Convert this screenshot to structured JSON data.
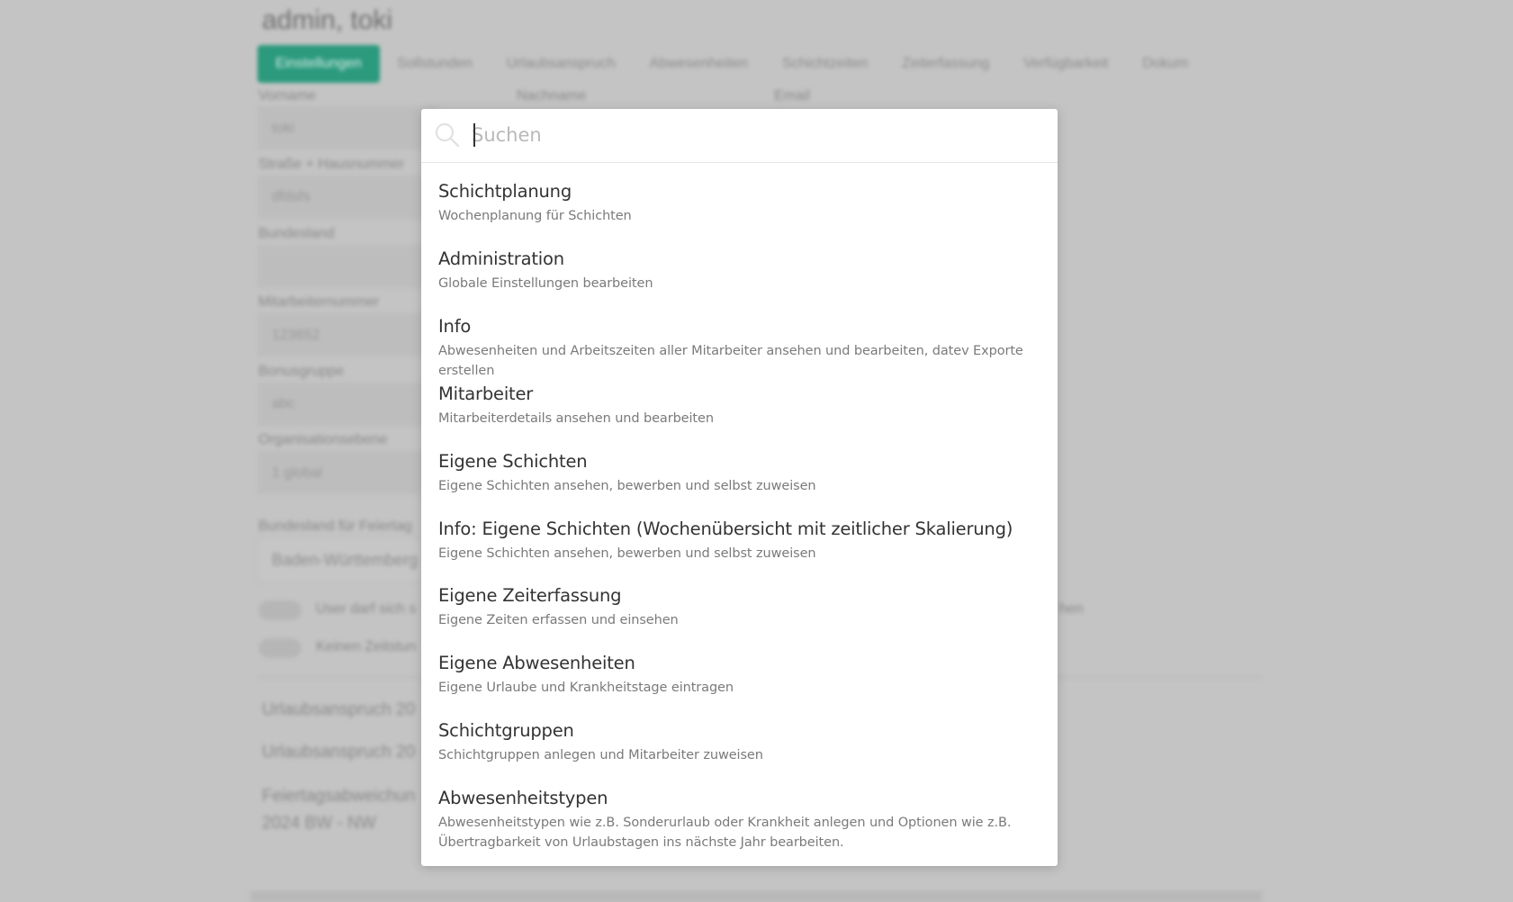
{
  "background": {
    "title": "admin, toki",
    "tabs": [
      "Einstellungen",
      "Sollstunden",
      "Urlaubsanspruch",
      "Abwesenheiten",
      "Schichtzeiten",
      "Zeiterfassung",
      "Verfügbarkeit",
      "Dokum"
    ],
    "labels": {
      "vorname": "Vorname",
      "nachname": "Nachname",
      "email": "Email",
      "strasse": "Straße + Hausnummer",
      "bundesland": "Bundesland",
      "mitarbeiternummer": "Mitarbeiternummer",
      "bonusgruppe": "Bonusgruppe",
      "organisationsebene": "Organisationsebene",
      "bundesland_feiertage": "Bundesland für Feiertag"
    },
    "values": {
      "vorname": "toki",
      "strasse": "dfdsfs",
      "mitarbeiternummer": "123652",
      "bonusgruppe": "abc",
      "organisationsebene": "1 global",
      "bundesland_feiertage": "Baden-Württemberg"
    },
    "toggles": [
      "User darf sich s",
      "Keinen Zeitstun"
    ],
    "toggle_suffix": "hen",
    "urlaub_rows": [
      "Urlaubsanspruch 20",
      "Urlaubsanspruch 20"
    ],
    "feiertag_line1": "Feiertagsabweichun",
    "feiertag_line2": "2024 BW - NW"
  },
  "search": {
    "placeholder": "Suchen",
    "value": ""
  },
  "items": [
    {
      "title": "Schichtplanung",
      "description": "Wochenplanung für Schichten"
    },
    {
      "title": "Administration",
      "description": "Globale Einstellungen bearbeiten"
    },
    {
      "title": "Info",
      "description": "Abwesenheiten und Arbeitszeiten aller Mitarbeiter ansehen und bearbeiten, datev Exporte erstellen"
    },
    {
      "title": "Mitarbeiter",
      "description": "Mitarbeiterdetails ansehen und bearbeiten"
    },
    {
      "title": "Eigene Schichten",
      "description": "Eigene Schichten ansehen, bewerben und selbst zuweisen"
    },
    {
      "title": "Info: Eigene Schichten (Wochenübersicht mit zeitlicher Skalierung)",
      "description": "Eigene Schichten ansehen, bewerben und selbst zuweisen"
    },
    {
      "title": "Eigene Zeiterfassung",
      "description": "Eigene Zeiten erfassen und einsehen"
    },
    {
      "title": "Eigene Abwesenheiten",
      "description": "Eigene Urlaube und Krankheitstage eintragen"
    },
    {
      "title": "Schichtgruppen",
      "description": "Schichtgruppen anlegen und Mitarbeiter zuweisen"
    },
    {
      "title": "Abwesenheitstypen",
      "description": "Abwesenheitstypen wie z.B. Sonderurlaub oder Krankheit anlegen und Optionen wie z.B. Übertragbarkeit von Urlaubstagen ins nächste Jahr bearbeiten."
    }
  ],
  "colors": {
    "overlay": "#c4c4c4",
    "accent_tab": "#2b9a7d",
    "title_text": "#333333",
    "desc_text": "#7a7a7a"
  }
}
